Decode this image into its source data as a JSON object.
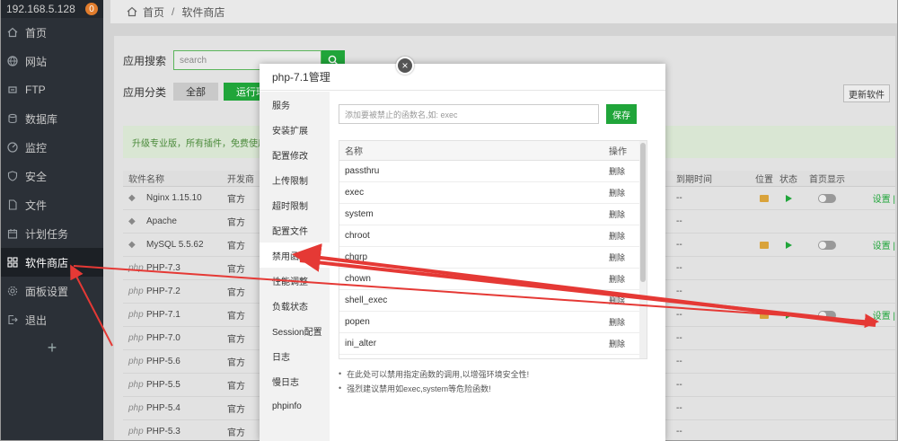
{
  "sidebar": {
    "ip": "192.168.5.128",
    "badge": "0",
    "items": [
      {
        "label": "首页",
        "icon": "home-icon"
      },
      {
        "label": "网站",
        "icon": "globe-icon"
      },
      {
        "label": "FTP",
        "icon": "ftp-icon"
      },
      {
        "label": "数据库",
        "icon": "database-icon"
      },
      {
        "label": "监控",
        "icon": "monitor-icon"
      },
      {
        "label": "安全",
        "icon": "shield-icon"
      },
      {
        "label": "文件",
        "icon": "file-icon"
      },
      {
        "label": "计划任务",
        "icon": "calendar-icon"
      },
      {
        "label": "软件商店",
        "icon": "grid-icon"
      },
      {
        "label": "面板设置",
        "icon": "gear-icon"
      },
      {
        "label": "退出",
        "icon": "logout-icon"
      }
    ],
    "plus": "+"
  },
  "breadcrumb": {
    "home": "首页",
    "sep": "/",
    "current": "软件商店"
  },
  "store": {
    "search_label": "应用搜索",
    "search_placeholder": "search",
    "category_label": "应用分类",
    "cat_all": "全部",
    "cat_run": "运行环",
    "update_btn": "更新软件",
    "promo": "升级专业版，所有插件，免费使用。",
    "headers": {
      "name": "软件名称",
      "dev": "开发商",
      "expire": "到期时间",
      "pos": "位置",
      "status": "状态",
      "home": "首页显示"
    },
    "rows": [
      {
        "name": "Nginx 1.15.10",
        "dev": "官方",
        "expire": "--",
        "op": "设置 |"
      },
      {
        "name": "Apache",
        "dev": "官方",
        "expire": "--",
        "op": ""
      },
      {
        "name": "MySQL 5.5.62",
        "dev": "官方",
        "expire": "--",
        "op": "设置 |"
      },
      {
        "name": "PHP-7.3",
        "dev": "官方",
        "expire": "--",
        "op": ""
      },
      {
        "name": "PHP-7.2",
        "dev": "官方",
        "expire": "--",
        "op": ""
      },
      {
        "name": "PHP-7.1",
        "dev": "官方",
        "expire": "--",
        "op": "设置 |"
      },
      {
        "name": "PHP-7.0",
        "dev": "官方",
        "expire": "--",
        "op": ""
      },
      {
        "name": "PHP-5.6",
        "dev": "官方",
        "expire": "--",
        "op": ""
      },
      {
        "name": "PHP-5.5",
        "dev": "官方",
        "expire": "--",
        "op": ""
      },
      {
        "name": "PHP-5.4",
        "dev": "官方",
        "expire": "--",
        "op": ""
      },
      {
        "name": "PHP-5.3",
        "dev": "官方",
        "expire": "--",
        "op": ""
      }
    ],
    "php_prefix": "php"
  },
  "modal": {
    "title": "php-7.1管理",
    "close": "×",
    "menu": [
      "服务",
      "安装扩展",
      "配置修改",
      "上传限制",
      "超时限制",
      "配置文件",
      "禁用函数",
      "性能调整",
      "负载状态",
      "Session配置",
      "日志",
      "慢日志",
      "phpinfo"
    ],
    "input_placeholder": "添加要被禁止的函数名,如: exec",
    "save": "保存",
    "table_header": {
      "name": "名称",
      "op": "操作"
    },
    "functions": [
      "passthru",
      "exec",
      "system",
      "chroot",
      "chgrp",
      "chown",
      "shell_exec",
      "popen",
      "ini_alter"
    ],
    "delete_label": "删除",
    "notes": [
      "在此处可以禁用指定函数的调用,以增强环境安全性!",
      "强烈建议禁用如exec,system等危险函数!"
    ]
  },
  "colors": {
    "accent": "#20a53a",
    "sidebar": "#2b3037",
    "arrow": "#e53935"
  }
}
